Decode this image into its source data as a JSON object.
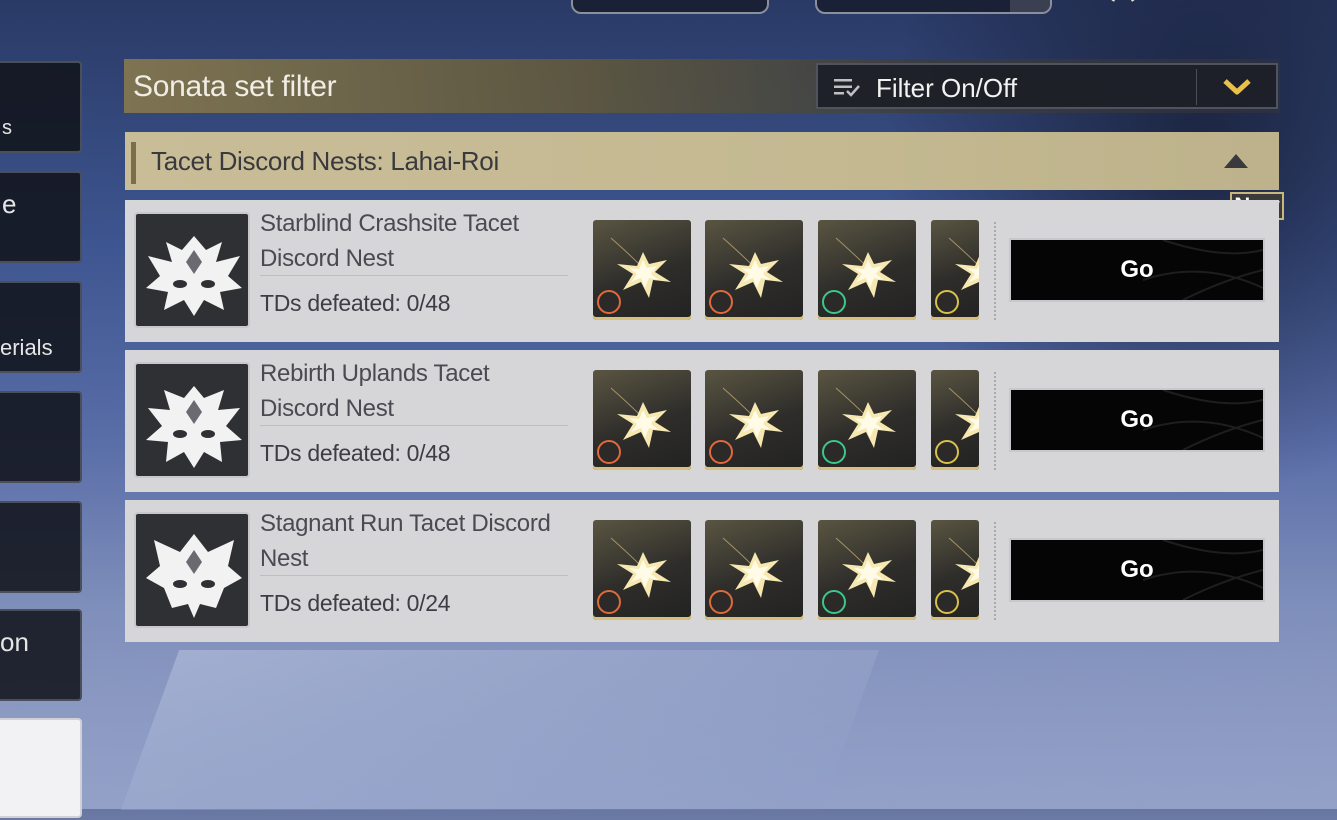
{
  "header": {
    "title": "Sonata set filter",
    "filter_label": "Filter On/Off"
  },
  "sidebar": {
    "items": [
      {
        "label": "s"
      },
      {
        "label": "e"
      },
      {
        "label": "erials"
      },
      {
        "label": ""
      },
      {
        "label": ""
      },
      {
        "label": "on"
      },
      {
        "label": ""
      }
    ]
  },
  "region": {
    "title": "Tacet Discord Nests: Lahai-Roi",
    "badge": "New"
  },
  "nests": [
    {
      "name": "Starblind Crashsite Tacet Discord Nest",
      "progress": "TDs defeated: 0/48",
      "action": "Go"
    },
    {
      "name": "Rebirth Uplands Tacet Discord Nest",
      "progress": "TDs defeated: 0/48",
      "action": "Go"
    },
    {
      "name": "Stagnant Run Tacet Discord Nest",
      "progress": "TDs defeated: 0/24",
      "action": "Go"
    }
  ],
  "sonata_badges": [
    {
      "icon": "heart-sonata-icon",
      "color": "#e06a3c"
    },
    {
      "icon": "compass-sonata-icon",
      "color": "#e06a3c"
    },
    {
      "icon": "target-sonata-icon",
      "color": "#3cc88a"
    },
    {
      "icon": "shield-sonata-icon",
      "color": "#d8c24a"
    }
  ],
  "colors": {
    "accent_gold": "#c9b87e",
    "go_button": "#050505"
  }
}
